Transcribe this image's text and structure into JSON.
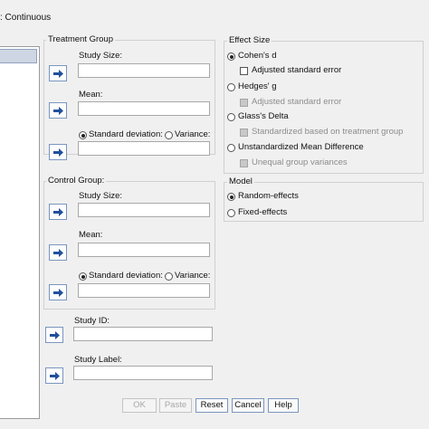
{
  "dialog": {
    "title": ": Continuous"
  },
  "treatment": {
    "group_label": "Treatment Group",
    "study_size_label": "Study Size:",
    "mean_label": "Mean:",
    "sd_label": "Standard deviation:",
    "variance_label": "Variance:"
  },
  "control": {
    "group_label": "Control Group:",
    "study_size_label": "Study Size:",
    "mean_label": "Mean:",
    "sd_label": "Standard deviation:",
    "variance_label": "Variance:"
  },
  "study": {
    "id_label": "Study ID:",
    "label_label": "Study Label:"
  },
  "effect_size": {
    "group_label": "Effect Size",
    "cohens_d": "Cohen's d",
    "adjusted_se_1": "Adjusted standard error",
    "hedges_g": "Hedges' g",
    "adjusted_se_2": "Adjusted standard error",
    "glass_delta": "Glass's Delta",
    "standardized_treatment": "Standardized based on treatment group",
    "unstandardized": "Unstandardized Mean Difference",
    "unequal_variances": "Unequal group variances"
  },
  "model": {
    "group_label": "Model",
    "random_effects": "Random-effects",
    "fixed_effects": "Fixed-effects"
  },
  "buttons": {
    "ok": "OK",
    "paste": "Paste",
    "reset": "Reset",
    "cancel": "Cancel",
    "help": "Help"
  },
  "icons": {
    "move_arrow": "arrow-right-icon"
  },
  "colors": {
    "background": "#f0f0f0",
    "button_border": "#7a96bf",
    "arrow": "#1f4f9c"
  }
}
